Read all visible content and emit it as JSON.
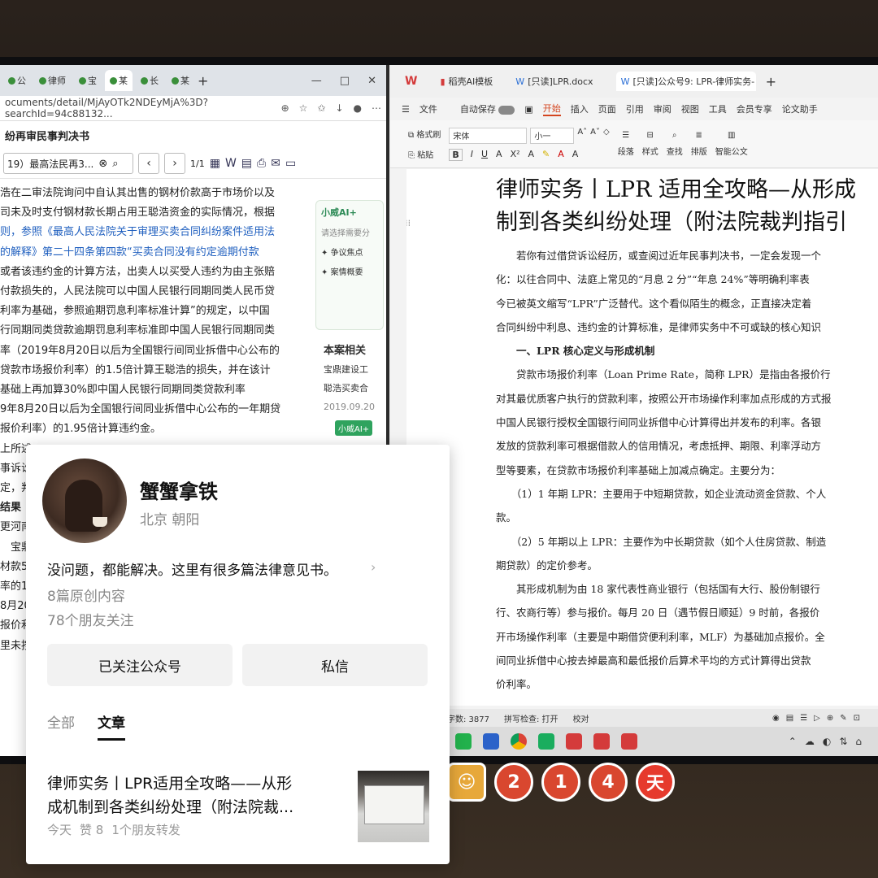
{
  "browser": {
    "tabs": [
      "公",
      "律师",
      "宝",
      "某",
      "长",
      "某"
    ],
    "url": "ocuments/detail/MjAyOTk2NDEyMjA%3D?searchId=94c88132...",
    "doc_title": "纷再审民事判决书",
    "search_value": "19）最高法民再3...",
    "page_indicator": "1/1",
    "judgment_lines": [
      "浩在二审法院询问中自认其出售的钢材价款高于市场价以及",
      "司未及时支付钢材款长期占用王聪浩资金的实际情况，根据",
      "则，参照《最高人民法院关于审理买卖合同纠纷案件适用法",
      "的解释》第二十四条第四款“买卖合同没有约定逾期付款",
      "或者该违约金的计算方法，出卖人以买受人违约为由主张赔",
      "付款损失的，人民法院可以中国人民银行同期同类人民币贷",
      "利率为基础，参照逾期罚息利率标准计算”的规定，以中国",
      "行同期同类贷款逾期罚息利率标准即中国人民银行同期同类",
      "率（2019年8月20日以后为全国银行间同业拆借中心公布的",
      "贷款市场报价利率）的1.5倍计算王聪浩的损失，并在该计",
      "基础上再加算30%即中国人民银行同期同类贷款利率",
      "9年8月20日以后为全国银行间同业拆借中心公布的一年期贷",
      "报价利率）的1.95倍计算违约金。",
      "",
      "上所述",
      "事诉讼",
      "定，判",
      "",
      "结果",
      "",
      "更河南",
      "　宝鼎",
      "材款5",
      "率的1",
      "8月20",
      "报价利",
      "",
      "里未按"
    ],
    "ai_panel": {
      "title": "小威AI+",
      "hint": "请选择需要分",
      "items": [
        "争议焦点",
        "案情概要"
      ]
    },
    "related": {
      "heading": "本案相关",
      "lines": [
        "宝鼎建设工",
        "聪浩买卖合"
      ],
      "date": "2019.09.20",
      "badge": "小威AI+"
    }
  },
  "wps": {
    "tabs": [
      "稻壳AI模板",
      "[只读]LPR.docx",
      "[只读]公众号9: LPR-律师实务-"
    ],
    "menu": [
      "文件",
      "自动保存",
      "开始",
      "插入",
      "页面",
      "引用",
      "审阅",
      "视图",
      "工具",
      "会员专享",
      "论文助手"
    ],
    "ribbon": {
      "format_painter": "格式刷",
      "paste": "粘贴",
      "font": "宋体",
      "size": "小一",
      "paragraph": "段落",
      "styles": "样式",
      "find": "查找",
      "layout": "排版",
      "smart": "智能公文"
    },
    "doc_title_lines": [
      "律师实务丨LPR 适用全攻略—从形成",
      "制到各类纠纷处理（附法院裁判指引"
    ],
    "body_lines": [
      "　　若你有过借贷诉讼经历，或查阅过近年民事判决书，一定会发现一个",
      "化：以往合同中、法庭上常见的“月息 2 分”“年息 24%”等明确利率表",
      "今已被英文缩写“LPR”广泛替代。这个看似陌生的概念，正直接决定着",
      "合同纠纷中利息、违约金的计算标准，是律师实务中不可或缺的核心知识",
      "　　一、LPR 核心定义与形成机制",
      "　　贷款市场报价利率（Loan Prime Rate，简称 LPR）是指由各报价行",
      "对其最优质客户执行的贷款利率，按照公开市场操作利率加点形成的方式报",
      "中国人民银行授权全国银行间同业拆借中心计算得出并发布的利率。各银",
      "发放的贷款利率可根据借款人的信用情况，考虑抵押、期限、利率浮动方",
      "型等要素，在贷款市场报价利率基础上加减点确定。主要分为：",
      "　　（1）1 年期 LPR：主要用于中短期贷款，如企业流动资金贷款、个人",
      "款。",
      "　　（2）5 年期以上 LPR：主要作为中长期贷款（如个人住房贷款、制造",
      "期贷款）的定价参考。",
      "　　其形成机制为由 18 家代表性商业银行（包括国有大行、股份制银行",
      "行、农商行等）参与报价。每月 20 日（遇节假日顺延）9 时前，各报价",
      "开市场操作利率（主要是中期借贷便利利率，MLF）为基础加点报价。全",
      "间同业拆借中心按去掉最高和最低报价后算术平均的方式计算得出贷款",
      "价利率。"
    ],
    "status": {
      "word_count": "字数: 3877",
      "spell": "拼写检查: 打开",
      "proof": "校对"
    }
  },
  "stickers": [
    "2",
    "1",
    "4",
    "天"
  ],
  "profile": {
    "name": "蟹蟹拿铁",
    "location": "北京 朝阳",
    "bio": "没问题，都能解决。这里有很多篇法律意见书。",
    "original_count": "8篇原创内容",
    "followers": "78个朋友关注",
    "follow_button": "已关注公众号",
    "message_button": "私信",
    "tabs": [
      "全部",
      "文章"
    ],
    "article": {
      "title_line1": "律师实务丨LPR适用全攻略——从形",
      "title_line2": "成机制到各类纠纷处理（附法院裁...",
      "date": "今天",
      "likes": "赞 8",
      "shares": "1个朋友转发"
    }
  },
  "colors": {
    "accent_wps": "#d4451f",
    "link_blue": "#1f5fbf",
    "ai_green": "#2fa35e"
  }
}
